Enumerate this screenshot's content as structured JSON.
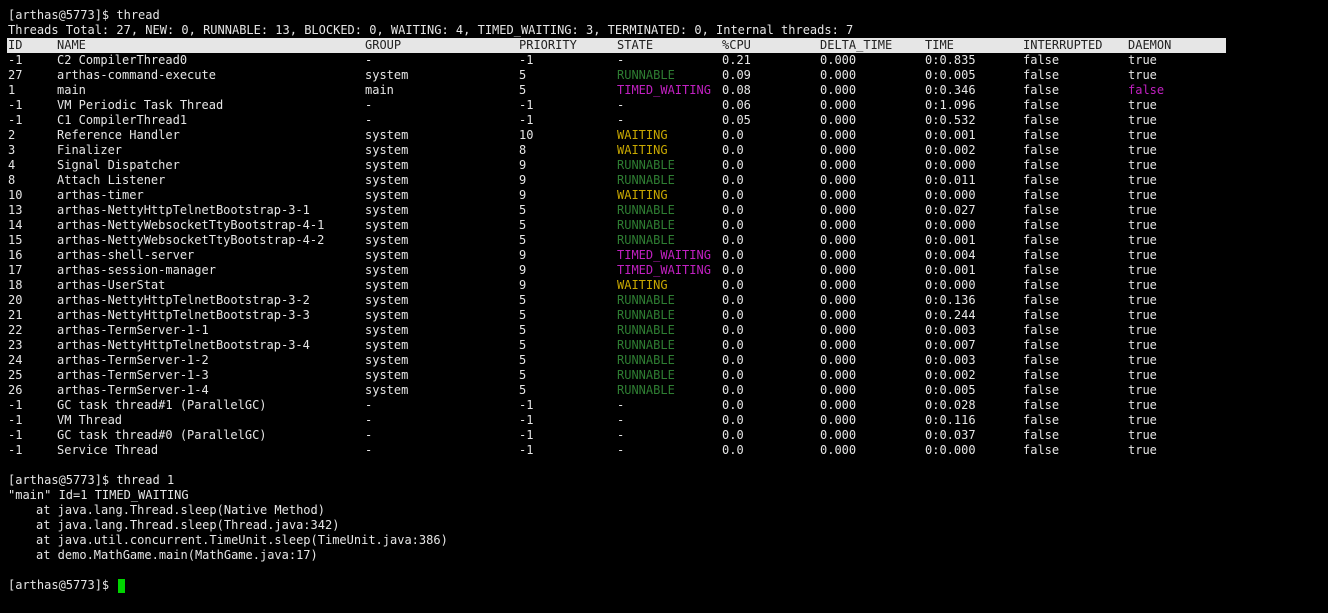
{
  "colors": {
    "background": "#000000",
    "text": "#e6e6e6",
    "header_bg": "#e6e6e6",
    "header_text": "#222222",
    "runnable": "#2e7d32",
    "waiting": "#c8a800",
    "timed_waiting": "#c020c0",
    "daemon_false": "#c020c0",
    "cursor": "#00d400"
  },
  "prompt": "[arthas@5773]$ ",
  "commands": {
    "first": "thread",
    "second": "thread 1"
  },
  "summary": "Threads Total: 27, NEW: 0, RUNNABLE: 13, BLOCKED: 0, WAITING: 4, TIMED_WAITING: 3, TERMINATED: 0, Internal threads: 7",
  "columns": [
    "ID",
    "NAME",
    "GROUP",
    "PRIORITY",
    "STATE",
    "%CPU",
    "DELTA_TIME",
    "TIME",
    "INTERRUPTED",
    "DAEMON"
  ],
  "threads": [
    [
      "-1",
      "C2 CompilerThread0",
      "-",
      "-1",
      "-",
      "0.21",
      "0.000",
      "0:0.835",
      "false",
      "true"
    ],
    [
      "27",
      "arthas-command-execute",
      "system",
      "5",
      "RUNNABLE",
      "0.09",
      "0.000",
      "0:0.005",
      "false",
      "true"
    ],
    [
      "1",
      "main",
      "main",
      "5",
      "TIMED_WAITING",
      "0.08",
      "0.000",
      "0:0.346",
      "false",
      "false"
    ],
    [
      "-1",
      "VM Periodic Task Thread",
      "-",
      "-1",
      "-",
      "0.06",
      "0.000",
      "0:1.096",
      "false",
      "true"
    ],
    [
      "-1",
      "C1 CompilerThread1",
      "-",
      "-1",
      "-",
      "0.05",
      "0.000",
      "0:0.532",
      "false",
      "true"
    ],
    [
      "2",
      "Reference Handler",
      "system",
      "10",
      "WAITING",
      "0.0",
      "0.000",
      "0:0.001",
      "false",
      "true"
    ],
    [
      "3",
      "Finalizer",
      "system",
      "8",
      "WAITING",
      "0.0",
      "0.000",
      "0:0.002",
      "false",
      "true"
    ],
    [
      "4",
      "Signal Dispatcher",
      "system",
      "9",
      "RUNNABLE",
      "0.0",
      "0.000",
      "0:0.000",
      "false",
      "true"
    ],
    [
      "8",
      "Attach Listener",
      "system",
      "9",
      "RUNNABLE",
      "0.0",
      "0.000",
      "0:0.011",
      "false",
      "true"
    ],
    [
      "10",
      "arthas-timer",
      "system",
      "9",
      "WAITING",
      "0.0",
      "0.000",
      "0:0.000",
      "false",
      "true"
    ],
    [
      "13",
      "arthas-NettyHttpTelnetBootstrap-3-1",
      "system",
      "5",
      "RUNNABLE",
      "0.0",
      "0.000",
      "0:0.027",
      "false",
      "true"
    ],
    [
      "14",
      "arthas-NettyWebsocketTtyBootstrap-4-1",
      "system",
      "5",
      "RUNNABLE",
      "0.0",
      "0.000",
      "0:0.000",
      "false",
      "true"
    ],
    [
      "15",
      "arthas-NettyWebsocketTtyBootstrap-4-2",
      "system",
      "5",
      "RUNNABLE",
      "0.0",
      "0.000",
      "0:0.001",
      "false",
      "true"
    ],
    [
      "16",
      "arthas-shell-server",
      "system",
      "9",
      "TIMED_WAITING",
      "0.0",
      "0.000",
      "0:0.004",
      "false",
      "true"
    ],
    [
      "17",
      "arthas-session-manager",
      "system",
      "9",
      "TIMED_WAITING",
      "0.0",
      "0.000",
      "0:0.001",
      "false",
      "true"
    ],
    [
      "18",
      "arthas-UserStat",
      "system",
      "9",
      "WAITING",
      "0.0",
      "0.000",
      "0:0.000",
      "false",
      "true"
    ],
    [
      "20",
      "arthas-NettyHttpTelnetBootstrap-3-2",
      "system",
      "5",
      "RUNNABLE",
      "0.0",
      "0.000",
      "0:0.136",
      "false",
      "true"
    ],
    [
      "21",
      "arthas-NettyHttpTelnetBootstrap-3-3",
      "system",
      "5",
      "RUNNABLE",
      "0.0",
      "0.000",
      "0:0.244",
      "false",
      "true"
    ],
    [
      "22",
      "arthas-TermServer-1-1",
      "system",
      "5",
      "RUNNABLE",
      "0.0",
      "0.000",
      "0:0.003",
      "false",
      "true"
    ],
    [
      "23",
      "arthas-NettyHttpTelnetBootstrap-3-4",
      "system",
      "5",
      "RUNNABLE",
      "0.0",
      "0.000",
      "0:0.007",
      "false",
      "true"
    ],
    [
      "24",
      "arthas-TermServer-1-2",
      "system",
      "5",
      "RUNNABLE",
      "0.0",
      "0.000",
      "0:0.003",
      "false",
      "true"
    ],
    [
      "25",
      "arthas-TermServer-1-3",
      "system",
      "5",
      "RUNNABLE",
      "0.0",
      "0.000",
      "0:0.002",
      "false",
      "true"
    ],
    [
      "26",
      "arthas-TermServer-1-4",
      "system",
      "5",
      "RUNNABLE",
      "0.0",
      "0.000",
      "0:0.005",
      "false",
      "true"
    ],
    [
      "-1",
      "GC task thread#1 (ParallelGC)",
      "-",
      "-1",
      "-",
      "0.0",
      "0.000",
      "0:0.028",
      "false",
      "true"
    ],
    [
      "-1",
      "VM Thread",
      "-",
      "-1",
      "-",
      "0.0",
      "0.000",
      "0:0.116",
      "false",
      "true"
    ],
    [
      "-1",
      "GC task thread#0 (ParallelGC)",
      "-",
      "-1",
      "-",
      "0.0",
      "0.000",
      "0:0.037",
      "false",
      "true"
    ],
    [
      "-1",
      "Service Thread",
      "-",
      "-1",
      "-",
      "0.0",
      "0.000",
      "0:0.000",
      "false",
      "true"
    ]
  ],
  "thread_detail": {
    "header": "\"main\" Id=1 TIMED_WAITING",
    "stack": [
      "at java.lang.Thread.sleep(Native Method)",
      "at java.lang.Thread.sleep(Thread.java:342)",
      "at java.util.concurrent.TimeUnit.sleep(TimeUnit.java:386)",
      "at demo.MathGame.main(MathGame.java:17)"
    ]
  }
}
